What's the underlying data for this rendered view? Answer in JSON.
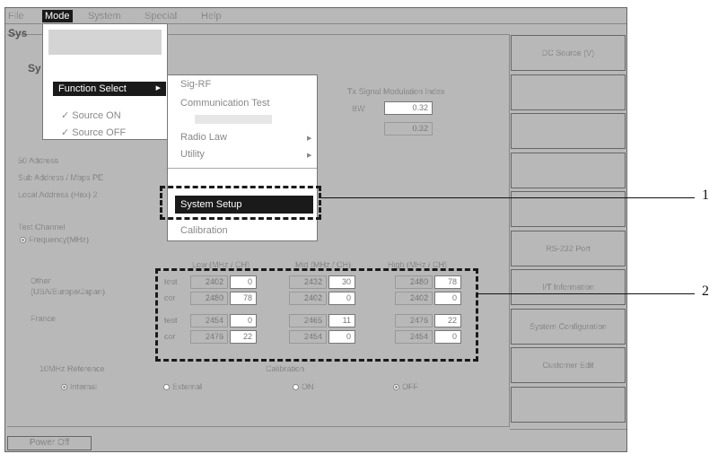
{
  "menubar": {
    "items": [
      "File",
      "Mode",
      "System",
      "Special",
      "Help"
    ],
    "active_index": 1
  },
  "window": {
    "title_fragment": "Sys",
    "subtitle_fragment": "Sy"
  },
  "mode_menu": {
    "items": [
      {
        "label": "Function Select",
        "has_submenu": true,
        "selected": true
      },
      {
        "label": "✓ Source ON",
        "has_submenu": false
      },
      {
        "label": "✓ Source OFF",
        "has_submenu": false
      }
    ]
  },
  "function_submenu": {
    "items": [
      {
        "label": "Sig-RF",
        "has_submenu": false
      },
      {
        "label": "Communication Test",
        "has_submenu": false
      },
      {
        "label": "Radio Law",
        "has_submenu": true
      },
      {
        "label": "Utility",
        "has_submenu": true
      },
      {
        "label": "System Setup",
        "has_submenu": false,
        "selected": true
      },
      {
        "label": "Calibration",
        "has_submenu": false
      }
    ]
  },
  "tx_modulation": {
    "title": "Tx Signal Modulation Index",
    "row1_label": "BW",
    "row1_value": "0.32",
    "row2_value": "0.32"
  },
  "address": {
    "header": "50 Address",
    "line1": "Sub Address / Mbps  PE",
    "line2": "Local Address (Hex) 2"
  },
  "test_channel": {
    "header": "Test Channel",
    "option": "Frequency(MHz)"
  },
  "freq_table": {
    "col_headers": [
      "Low (MHz / CH)",
      "Mid (MHz / CH)",
      "High (MHz / CH)"
    ],
    "groups": [
      {
        "name": "Other",
        "sub": "(USA/Europe/Japan)",
        "rows": [
          {
            "tag": "test",
            "low_mhz": "2402",
            "low_ch": "0",
            "mid_mhz": "2432",
            "mid_ch": "30",
            "high_mhz": "2480",
            "high_ch": "78"
          },
          {
            "tag": "cor",
            "low_mhz": "2480",
            "low_ch": "78",
            "mid_mhz": "2402",
            "mid_ch": "0",
            "high_mhz": "2402",
            "high_ch": "0"
          }
        ]
      },
      {
        "name": "France",
        "sub": "",
        "rows": [
          {
            "tag": "test",
            "low_mhz": "2454",
            "low_ch": "0",
            "mid_mhz": "2465",
            "mid_ch": "11",
            "high_mhz": "2476",
            "high_ch": "22"
          },
          {
            "tag": "cor",
            "low_mhz": "2476",
            "low_ch": "22",
            "mid_mhz": "2454",
            "mid_ch": "0",
            "high_mhz": "2454",
            "high_ch": "0"
          }
        ]
      }
    ]
  },
  "reference": {
    "header": "10MHz Reference",
    "options": [
      "Internal",
      "External"
    ],
    "selected": 0
  },
  "calibration": {
    "header": "Calibration",
    "options": [
      "ON",
      "OFF"
    ],
    "selected": 1
  },
  "right_buttons": [
    "DC Source (V)",
    "",
    "",
    "",
    "",
    "RS-232 Port",
    "I/T Information",
    "System Configuration",
    "Customer Edit",
    ""
  ],
  "footer": {
    "power_button": "Power Off"
  },
  "callouts": [
    "1",
    "2"
  ]
}
